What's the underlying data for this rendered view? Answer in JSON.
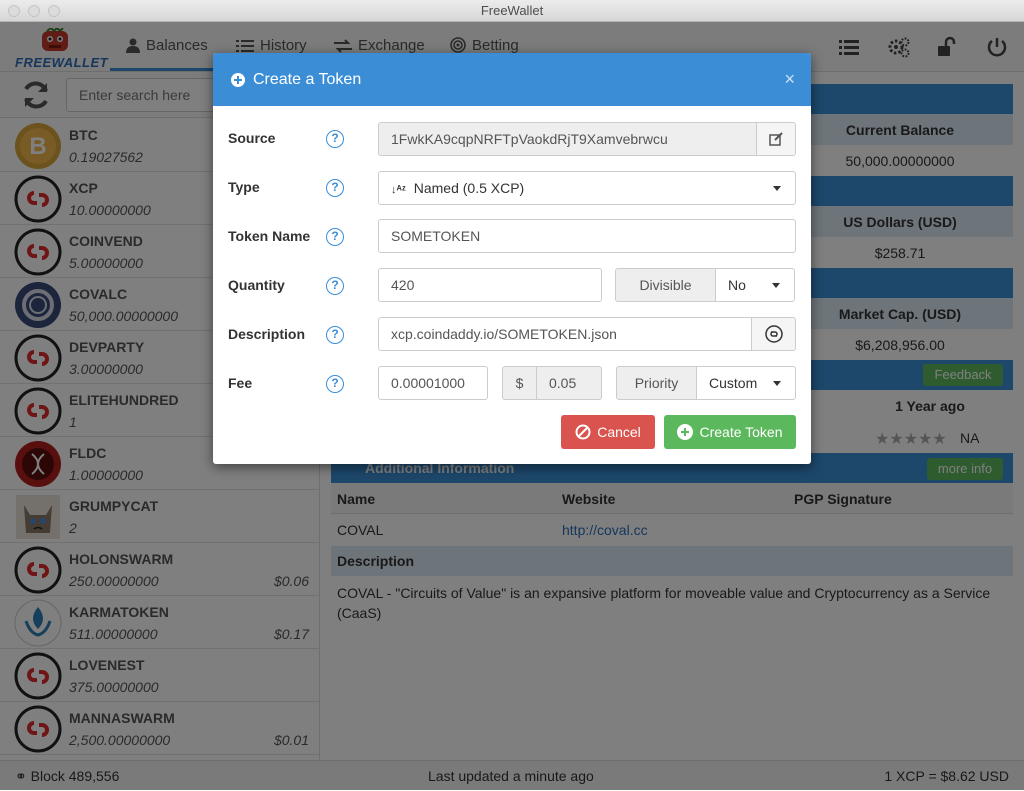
{
  "window": {
    "title": "FreeWallet"
  },
  "brand": {
    "logo_text": "FREEWALLET"
  },
  "nav": {
    "tabs": [
      {
        "label": "Balances",
        "icon": "user-icon"
      },
      {
        "label": "History",
        "icon": "list-icon"
      },
      {
        "label": "Exchange",
        "icon": "exchange-icon"
      },
      {
        "label": "Betting",
        "icon": "target-icon"
      }
    ],
    "right_icons": [
      "list-icon",
      "gears-icon",
      "unlock-icon",
      "power-icon"
    ]
  },
  "search": {
    "placeholder": "Enter search here"
  },
  "tokens": [
    {
      "name": "BTC",
      "balance": "0.19027562",
      "usd": "",
      "icon": "bitcoin-icon"
    },
    {
      "name": "XCP",
      "balance": "10.00000000",
      "usd": "",
      "icon": "counterparty-icon"
    },
    {
      "name": "COINVEND",
      "balance": "5.00000000",
      "usd": "",
      "icon": "counterparty-icon"
    },
    {
      "name": "COVALC",
      "balance": "50,000.00000000",
      "usd": "",
      "icon": "coval-icon"
    },
    {
      "name": "DEVPARTY",
      "balance": "3.00000000",
      "usd": "",
      "icon": "counterparty-icon"
    },
    {
      "name": "ELITEHUNDRED",
      "balance": "1",
      "usd": "",
      "icon": "counterparty-icon"
    },
    {
      "name": "FLDC",
      "balance": "1.00000000",
      "usd": "",
      "icon": "fldc-icon"
    },
    {
      "name": "GRUMPYCAT",
      "balance": "2",
      "usd": "",
      "icon": "grumpycat-icon"
    },
    {
      "name": "HOLONSWARM",
      "balance": "250.00000000",
      "usd": "$0.06",
      "icon": "counterparty-icon"
    },
    {
      "name": "KARMATOKEN",
      "balance": "511.00000000",
      "usd": "$0.17",
      "icon": "karma-icon"
    },
    {
      "name": "LOVENEST",
      "balance": "375.00000000",
      "usd": "",
      "icon": "counterparty-icon"
    },
    {
      "name": "MANNASWARM",
      "balance": "2,500.00000000",
      "usd": "$0.01",
      "icon": "counterparty-icon"
    }
  ],
  "main": {
    "current_balance_label": "Current Balance",
    "current_balance_value": "50,000.00000000",
    "usd_label": "US Dollars (USD)",
    "usd_value": "$258.71",
    "market_cap_label": "Market Cap. (USD)",
    "market_cap_value": "$6,208,956.00",
    "feedback_button": "Feedback",
    "age_label": "1 Year ago",
    "rating_value": "NA",
    "additional_info_title": "Additional Information",
    "more_info_button": "more info",
    "info_table": {
      "headers": [
        "Name",
        "Website",
        "PGP Signature"
      ],
      "row": [
        "COVAL",
        "http://coval.cc",
        ""
      ]
    },
    "description_label": "Description",
    "description_text": "COVAL - \"Circuits of Value\" is an expansive platform for moveable value and Cryptocurrency as a Service (CaaS)"
  },
  "status": {
    "block": "Block 489,556",
    "updated": "Last updated a minute ago",
    "price": "1 XCP = $8.62 USD"
  },
  "modal": {
    "title": "Create a Token",
    "close": "×",
    "source_label": "Source",
    "source_value": "1FwkKA9cqpNRFTpVaokdRjT9Xamvebrwcu",
    "type_label": "Type",
    "type_value": "Named (0.5 XCP)",
    "token_name_label": "Token Name",
    "token_name_value": "SOMETOKEN",
    "quantity_label": "Quantity",
    "quantity_value": "420",
    "divisible_label": "Divisible",
    "divisible_value": "No",
    "description_label": "Description",
    "description_value": "xcp.coindaddy.io/SOMETOKEN.json",
    "fee_label": "Fee",
    "fee_value": "0.00001000",
    "currency_symbol": "$",
    "fee_usd": "0.05",
    "priority_label": "Priority",
    "priority_value": "Custom",
    "help_glyph": "?",
    "cancel_button": "Cancel",
    "create_button": "Create Token"
  },
  "colors": {
    "primary": "#3b8ed6",
    "danger": "#d9534f",
    "success": "#5cb85c",
    "counterparty_red": "#e02b2b"
  }
}
